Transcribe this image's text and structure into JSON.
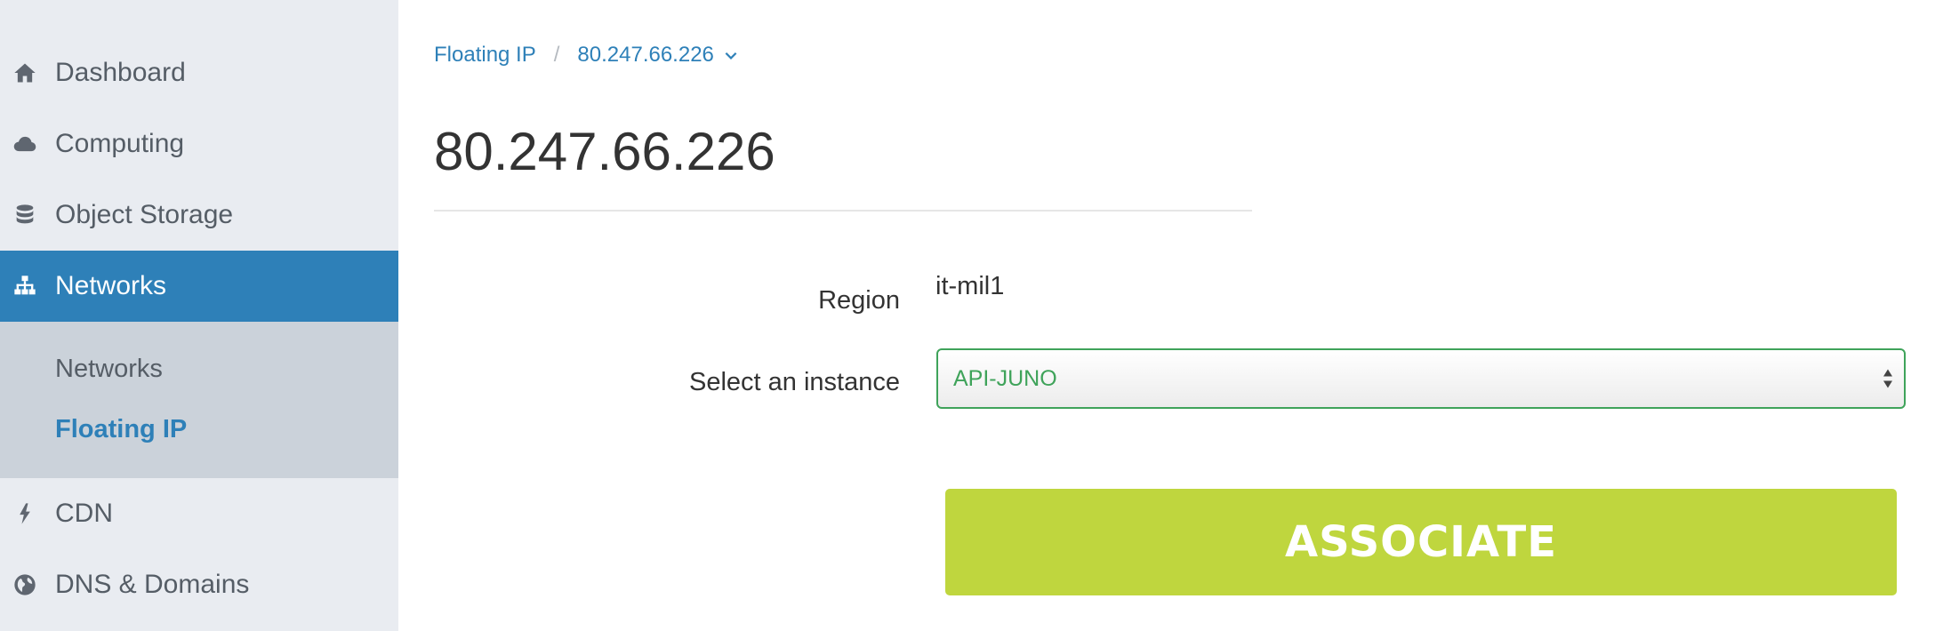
{
  "sidebar": {
    "items": [
      {
        "label": "Dashboard",
        "icon": "home-icon"
      },
      {
        "label": "Computing",
        "icon": "cloud-icon"
      },
      {
        "label": "Object Storage",
        "icon": "database-icon"
      },
      {
        "label": "Networks",
        "icon": "sitemap-icon",
        "active": true
      },
      {
        "label": "CDN",
        "icon": "bolt-icon"
      },
      {
        "label": "DNS & Domains",
        "icon": "globe-icon"
      }
    ],
    "subitems": [
      {
        "label": "Networks"
      },
      {
        "label": "Floating IP",
        "active": true
      }
    ]
  },
  "breadcrumb": {
    "parent": "Floating IP",
    "separator": "/",
    "current": "80.247.66.226"
  },
  "page": {
    "title": "80.247.66.226"
  },
  "form": {
    "region_label": "Region",
    "region_value": "it-mil1",
    "instance_label": "Select an instance",
    "instance_selected": "API-JUNO"
  },
  "actions": {
    "associate_label": "ASSOCIATE"
  },
  "colors": {
    "accent": "#2e80b8",
    "button": "#bfd63e",
    "select_border": "#3fa35a",
    "sidebar_bg": "#e9ecf1",
    "subnav_bg": "#cbd2da"
  }
}
